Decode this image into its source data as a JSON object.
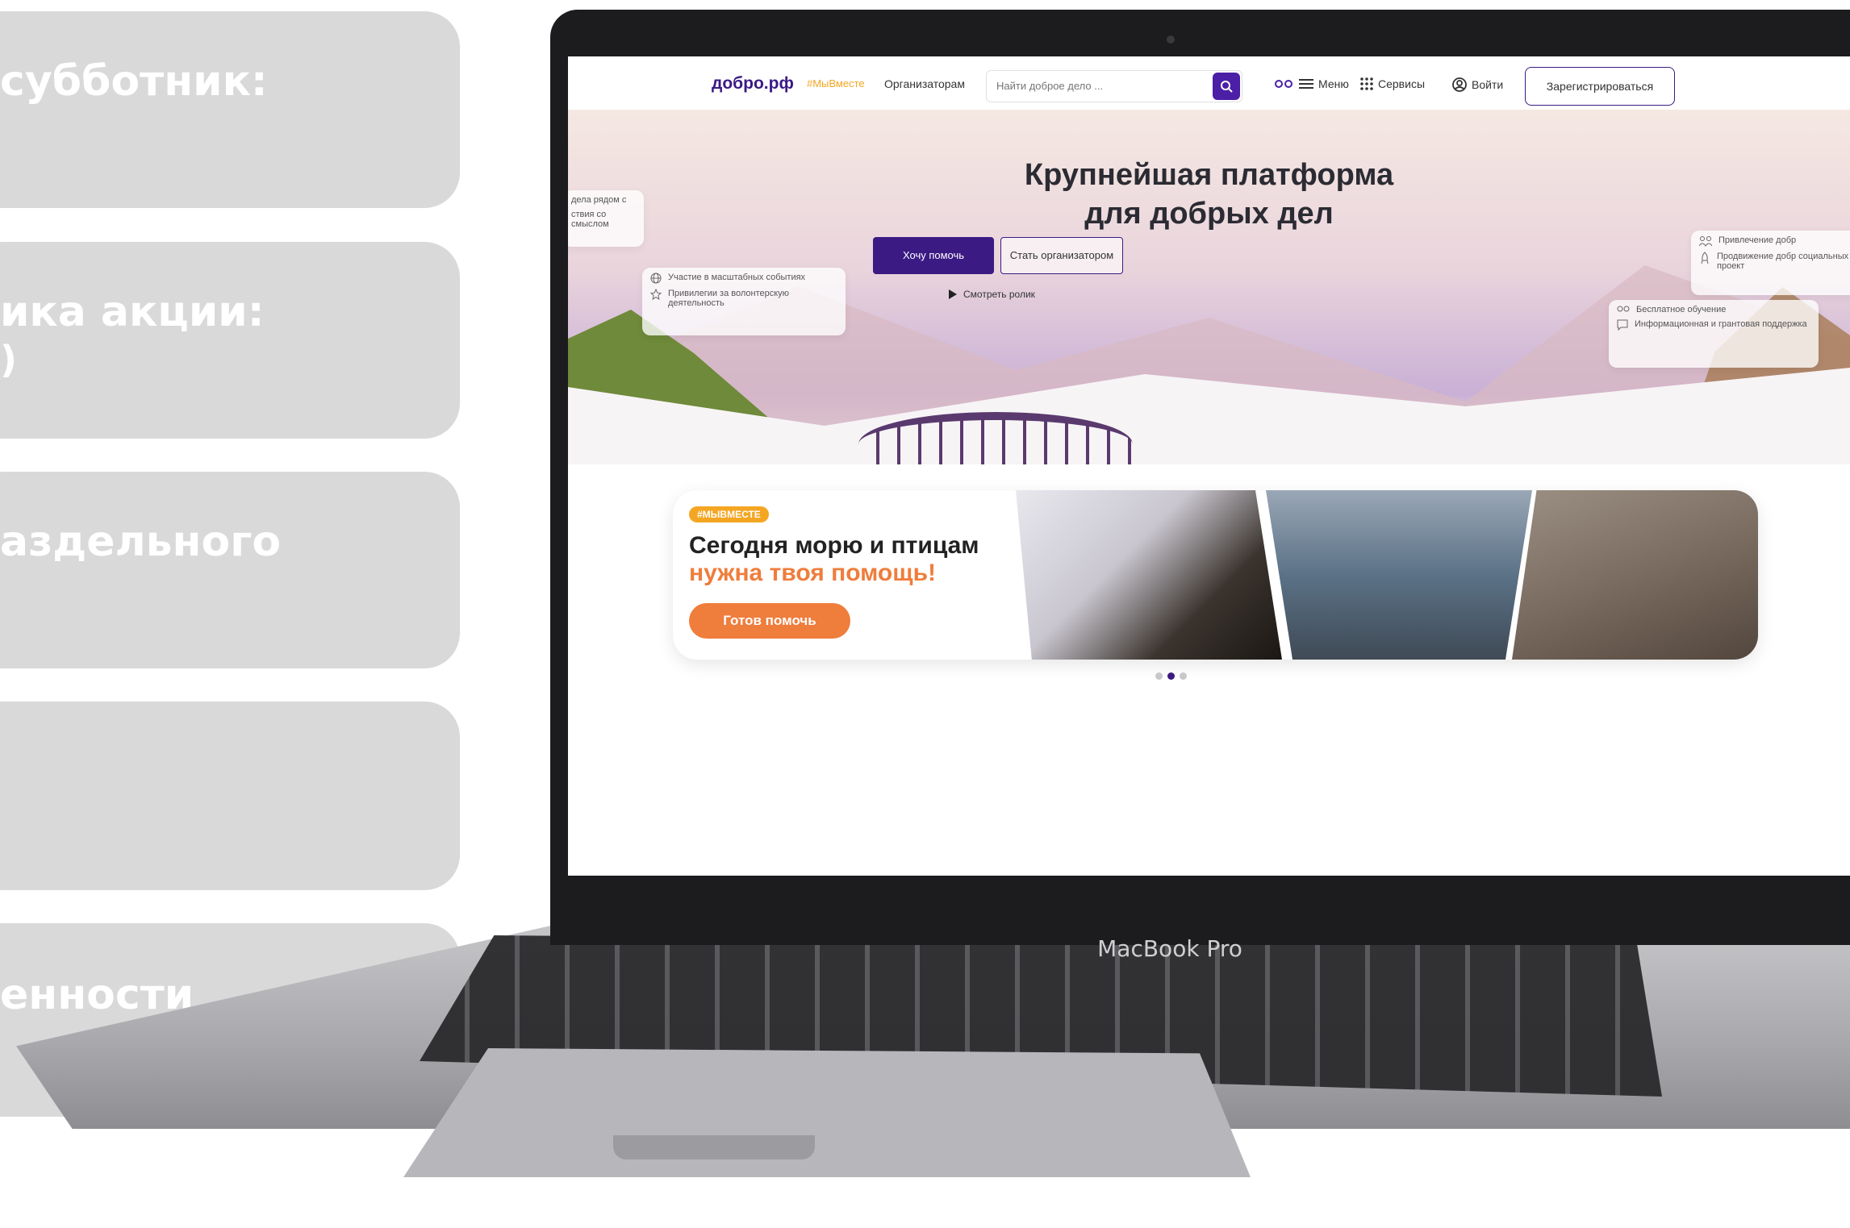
{
  "slides": [
    {
      "line1": "субботник:",
      "line2": ""
    },
    {
      "line1": "ика акции:",
      "line2": ")"
    },
    {
      "line1": "аздельного",
      "line2": ""
    },
    {
      "line1": "",
      "line2": ""
    },
    {
      "line1": "енности",
      "line2": ""
    }
  ],
  "laptop": {
    "label": "MacBook Pro"
  },
  "site": {
    "logo": "добро.рф",
    "hashtag": "#МыВместе",
    "organizers": "Организаторам",
    "search_placeholder": "Найти доброе дело ...",
    "menu": "Меню",
    "services": "Сервисы",
    "login": "Войти",
    "register": "Зарегистрироваться"
  },
  "hero": {
    "title_line1": "Крупнейшая платформа",
    "title_line2": "для добрых дел",
    "help_button": "Хочу помочь",
    "organizer_button": "Стать организатором",
    "video_link": "Смотреть ролик"
  },
  "tips": {
    "left_top": [
      "дела рядом с",
      "ствия со смыслом"
    ],
    "left_mid": [
      "Участие в масштабных событиях",
      "Привилегии за волонтерскую деятельность"
    ],
    "right_top": [
      "Привлечение добр",
      "Продвижение добр социальных проект"
    ],
    "right_mid": [
      "Бесплатное обучение",
      "Информационная и грантовая поддержка"
    ]
  },
  "promo": {
    "badge": "#МЫВМЕСТЕ",
    "title": "Сегодня морю и птицам",
    "subtitle": "нужна твоя помощь!",
    "button": "Готов помочь"
  },
  "carousel": {
    "count": 3,
    "active": 1
  },
  "colors": {
    "brand": "#3b1a84",
    "accent": "#ef7d3c",
    "tag": "#f4a623",
    "card": "#d9d9d9"
  }
}
